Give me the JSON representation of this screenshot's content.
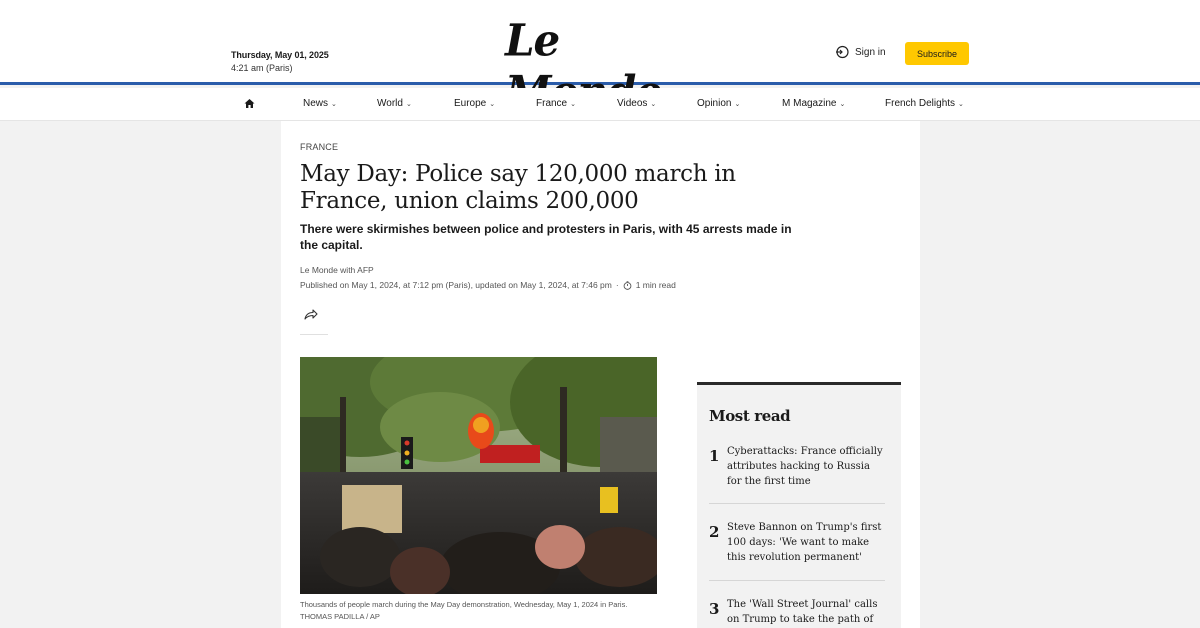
{
  "header": {
    "date": "Thursday, May 01, 2025",
    "time": "4:21 am (Paris)",
    "logo": "Le Monde",
    "signin_label": "Sign in",
    "subscribe_label": "Subscribe",
    "accent_color": "#2a5caa",
    "subscribe_color": "#ffc800"
  },
  "nav": {
    "home_icon": "home-icon",
    "items": [
      {
        "label": "News"
      },
      {
        "label": "World"
      },
      {
        "label": "Europe"
      },
      {
        "label": "France"
      },
      {
        "label": "Videos"
      },
      {
        "label": "Opinion"
      },
      {
        "label": "M Magazine"
      },
      {
        "label": "French Delights"
      }
    ]
  },
  "article": {
    "kicker": "FRANCE",
    "headline": "May Day: Police say 120,000 march in France, union claims 200,000",
    "standfirst": "There were skirmishes between police and protesters in Paris, with 45 arrests made in the capital.",
    "byline": "Le Monde with AFP",
    "published": "Published on May 1, 2024, at 7:12 pm (Paris), updated on May 1, 2024, at 7:46 pm",
    "separator": "·",
    "read_time": "1 min read",
    "caption": "Thousands of people march during the May Day demonstration, Wednesday, May 1, 2024 in Paris. THOMAS PADILLA / AP"
  },
  "most_read": {
    "title": "Most read",
    "items": [
      {
        "num": "1",
        "text": "Cyberattacks: France officially attributes hacking to Russia for the first time"
      },
      {
        "num": "2",
        "text": "Steve Bannon on Trump's first 100 days: 'We want to make this revolution permanent'"
      },
      {
        "num": "3",
        "text": "The 'Wall Street Journal' calls on Trump to take the path of"
      }
    ]
  }
}
